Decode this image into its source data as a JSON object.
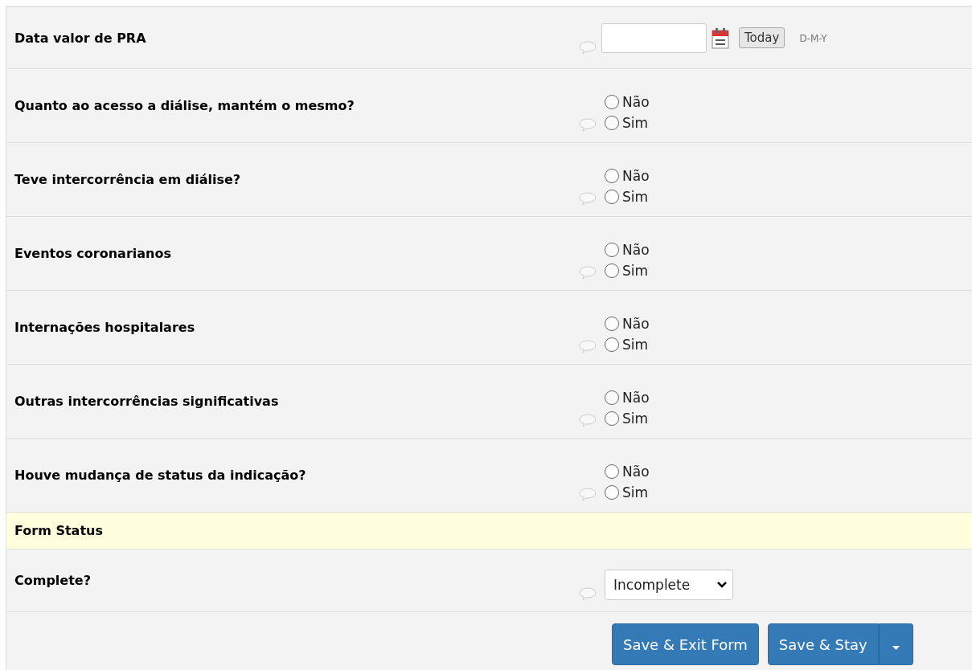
{
  "fields": [
    {
      "kind": "date",
      "label": "Data valor de PRA",
      "today_button": "Today",
      "format": "D-M-Y"
    },
    {
      "kind": "radio",
      "label": "Quanto ao acesso a diálise, mantém o mesmo?",
      "options": [
        {
          "label": "Não",
          "selected": false
        },
        {
          "label": "Sim",
          "selected": false
        }
      ]
    },
    {
      "kind": "radio",
      "label": "Teve intercorrência em diálise?",
      "options": [
        {
          "label": "Não",
          "selected": false
        },
        {
          "label": "Sim",
          "selected": false
        }
      ]
    },
    {
      "kind": "radio",
      "label": "Eventos coronarianos",
      "options": [
        {
          "label": "Não",
          "selected": false
        },
        {
          "label": "Sim",
          "selected": false
        }
      ]
    },
    {
      "kind": "radio",
      "label": "Internações hospitalares",
      "options": [
        {
          "label": "Não",
          "selected": false
        },
        {
          "label": "Sim",
          "selected": false
        }
      ]
    },
    {
      "kind": "radio",
      "label": "Outras intercorrências significativas",
      "options": [
        {
          "label": "Não",
          "selected": false
        },
        {
          "label": "Sim",
          "selected": false
        }
      ]
    },
    {
      "kind": "radio",
      "label": "Houve mudança de status da indicação?",
      "options": [
        {
          "label": "Não",
          "selected": false
        },
        {
          "label": "Sim",
          "selected": false
        }
      ]
    }
  ],
  "form_status": {
    "header": "Form Status",
    "label": "Complete?",
    "value": "Incomplete"
  },
  "buttons": {
    "save_exit": "Save & Exit Form",
    "save_stay": "Save & Stay"
  }
}
